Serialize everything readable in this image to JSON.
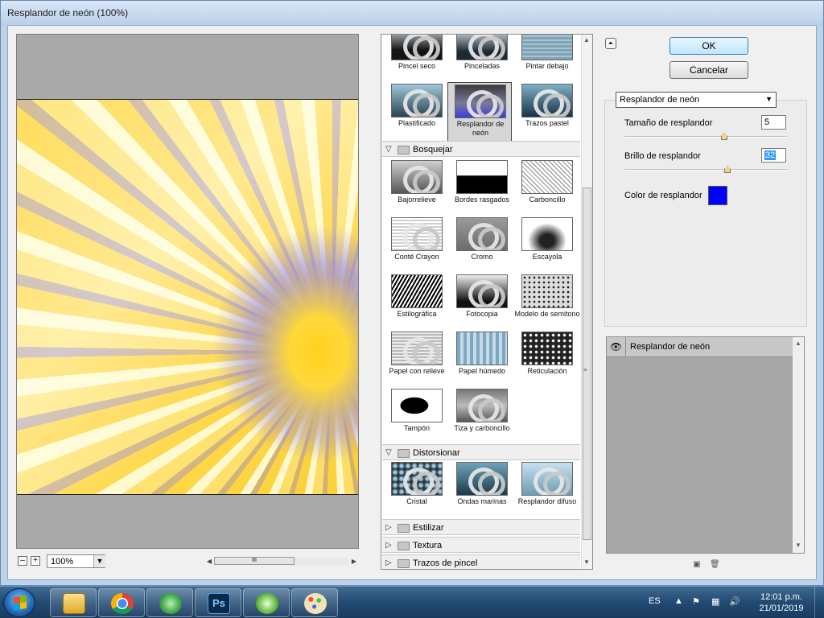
{
  "window": {
    "title": "Resplandor de neón (100%)"
  },
  "preview": {
    "zoom": "100%",
    "zoom_minus": "–",
    "zoom_plus": "+",
    "scroll_grip": "III"
  },
  "gallery": {
    "rows_top": [
      {
        "items": [
          {
            "label": "Pincel seco"
          },
          {
            "label": "Pinceladas"
          },
          {
            "label": "Pintar debajo"
          }
        ]
      },
      {
        "items": [
          {
            "label": "Plastificado"
          },
          {
            "label": "Resplandor de neón",
            "selected": true
          },
          {
            "label": "Trazos pastel"
          }
        ]
      }
    ],
    "categories": [
      {
        "name": "Bosquejar",
        "expanded": true,
        "items": [
          "Bajorrelieve",
          "Bordes rasgados",
          "Carboncillo",
          "Conté Crayon",
          "Cromo",
          "Escayola",
          "Estilográfica",
          "Fotocopia",
          "Modelo de semitono",
          "Papel con relieve",
          "Papel húmedo",
          "Reticulación",
          "Tampón",
          "Tiza y carboncillo"
        ]
      },
      {
        "name": "Distorsionar",
        "expanded": true,
        "items": [
          "Cristal",
          "Ondas marinas",
          "Resplandor difuso"
        ]
      },
      {
        "name": "Estilizar",
        "expanded": false
      },
      {
        "name": "Textura",
        "expanded": false
      },
      {
        "name": "Trazos de pincel",
        "expanded": false
      }
    ]
  },
  "buttons": {
    "ok": "OK",
    "cancel": "Cancelar",
    "collapse": "⏶"
  },
  "settings": {
    "filter": "Resplandor de neón",
    "size_label": "Tamaño de resplandor",
    "size_value": "5",
    "brightness_label": "Brillo de resplandor",
    "brightness_value": "32",
    "color_label": "Color de resplandor",
    "color": "#0000ff",
    "size_fraction": 0.62,
    "brightness_fraction": 0.64
  },
  "layers": {
    "items": [
      {
        "name": "Resplandor de neón",
        "visible": true
      }
    ]
  },
  "taskbar": {
    "lang": "ES",
    "time": "12:01 p.m.",
    "date": "21/01/2019",
    "apps": [
      "explorer-icon",
      "chrome-icon",
      "network-icon",
      "photoshop-icon",
      "archive-icon",
      "paint-icon"
    ],
    "photoshop_label": "Ps"
  },
  "colors": {
    "accent": "#3399ff",
    "preview_yellow": "#ffd83a",
    "preview_blue": "#7b70e6",
    "window_frame": "#bcd3ea"
  }
}
